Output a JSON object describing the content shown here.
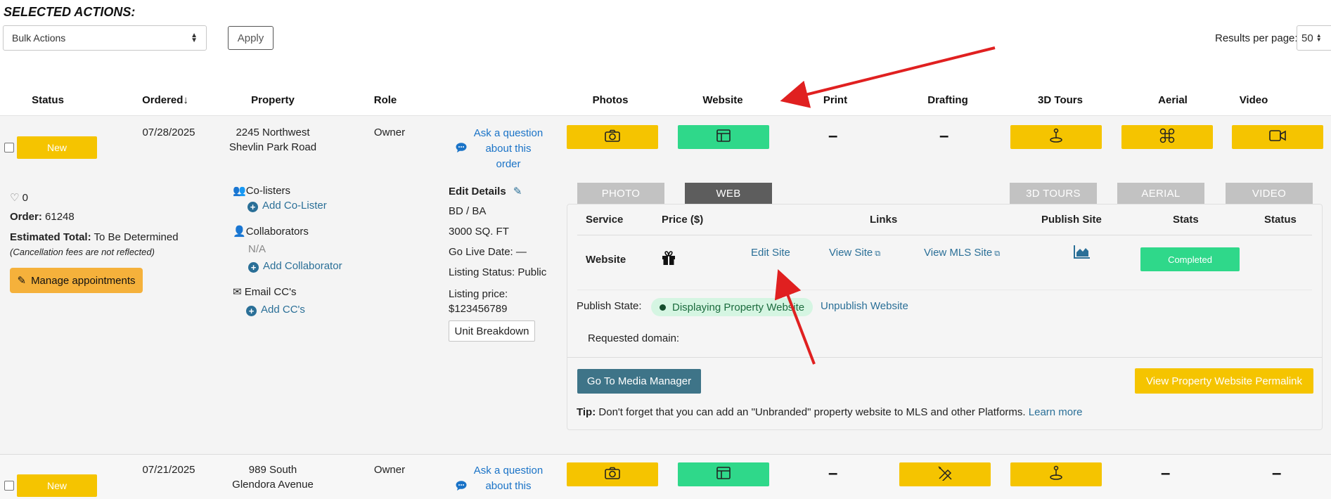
{
  "toolbar": {
    "title": "SELECTED ACTIONS:",
    "bulk_actions": "Bulk Actions",
    "apply": "Apply",
    "results_per_page_label": "Results per page:",
    "results_per_page_value": "50"
  },
  "columns": {
    "status": "Status",
    "ordered": "Ordered",
    "property": "Property",
    "role": "Role",
    "photos": "Photos",
    "website": "Website",
    "print": "Print",
    "drafting": "Drafting",
    "tours": "3D Tours",
    "aerial": "Aerial",
    "video": "Video"
  },
  "order1": {
    "status": "New",
    "date": "07/28/2025",
    "address_line1": "2245 Northwest",
    "address_line2": "Shevlin Park Road",
    "role": "Owner",
    "ask_line1": "Ask a question",
    "ask_line2": "about this",
    "ask_line3": "order",
    "dash": "–",
    "likes": "0",
    "order_label": "Order:",
    "order_number": "61248",
    "estimated_label": "Estimated Total:",
    "estimated_value": "To Be Determined",
    "cancellation_note": "(Cancellation fees are not reflected)",
    "manage_appointments": "Manage appointments",
    "colisters_label": "Co-listers",
    "add_colister": "Add Co-Lister",
    "collaborators_label": "Collaborators",
    "collaborators_value": "N/A",
    "add_collaborator": "Add Collaborator",
    "email_cc_label": "Email CC's",
    "add_cc": "Add CC's",
    "edit_details": "Edit Details",
    "bd_ba": "BD / BA",
    "sqft": "3000 SQ. FT",
    "go_live": "Go Live Date: —",
    "listing_status": "Listing Status: Public",
    "listing_price_label": "Listing price:",
    "listing_price_value": "$123456789",
    "unit_breakdown": "Unit Breakdown"
  },
  "tabs": {
    "photo": "PHOTO",
    "web": "WEB",
    "tours": "3D TOURS",
    "aerial": "AERIAL",
    "video": "VIDEO"
  },
  "web_panel": {
    "headers": {
      "service": "Service",
      "price": "Price ($)",
      "links": "Links",
      "publish_site": "Publish Site",
      "stats": "Stats",
      "status": "Status"
    },
    "service_name": "Website",
    "edit_site": "Edit Site",
    "view_site": "View Site",
    "view_mls_site": "View MLS Site",
    "status": "Completed",
    "publish_state_label": "Publish State:",
    "publish_state_value": "Displaying Property Website",
    "unpublish": "Unpublish Website",
    "requested_domain_label": "Requested domain:",
    "media_manager": "Go To Media Manager",
    "permalink": "View Property Website Permalink",
    "tip_label": "Tip:",
    "tip_text": "Don't forget that you can add an \"Unbranded\" property website to MLS and other Platforms.",
    "learn_more": "Learn more"
  },
  "order2": {
    "status": "New",
    "date": "07/21/2025",
    "address_line1": "989 South",
    "address_line2": "Glendora Avenue",
    "role": "Owner",
    "ask_line1": "Ask a question",
    "ask_line2": "about this",
    "dash": "–"
  },
  "colors": {
    "yellow": "#f5c400",
    "green": "#2fd88a",
    "teal": "#3e7488",
    "link_blue": "#1a73c7",
    "annotation_red": "#e02020"
  }
}
